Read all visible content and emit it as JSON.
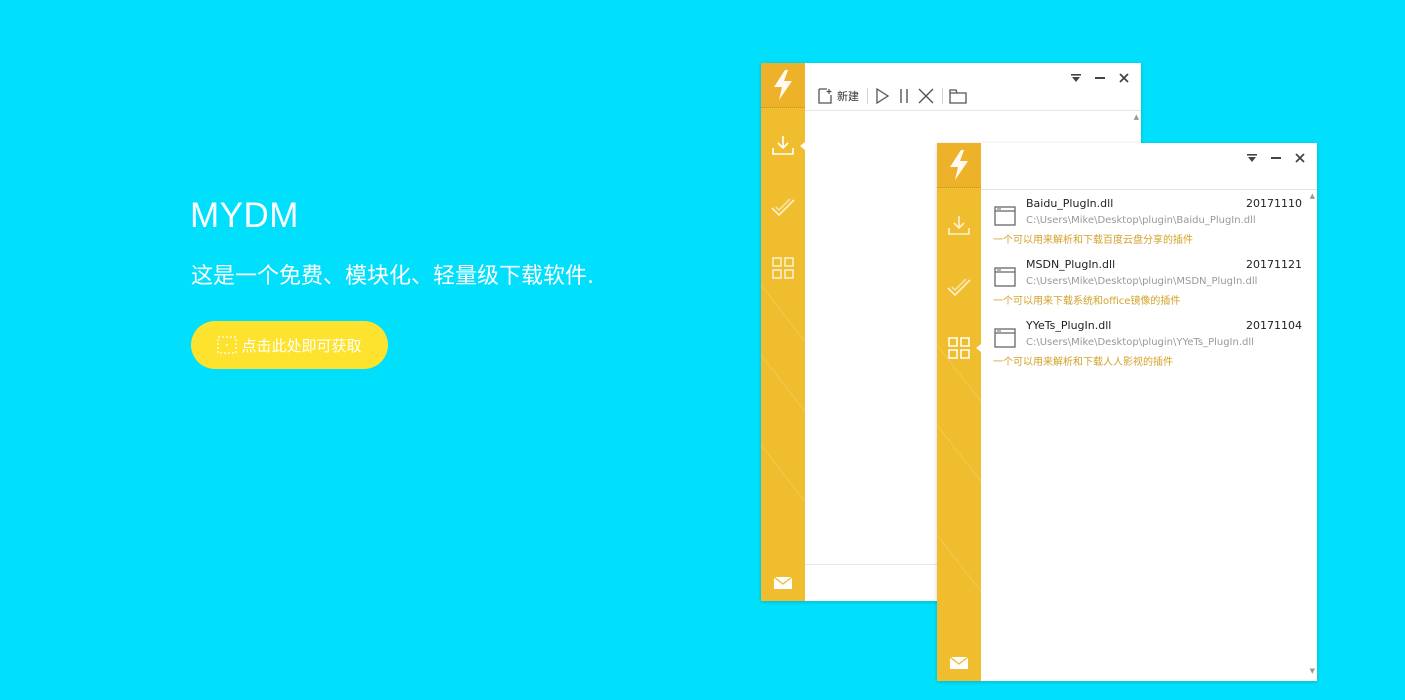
{
  "hero": {
    "title": "MYDM",
    "subtitle": "这是一个免费、模块化、轻量级下载软件.",
    "cta_label": "点击此处即可获取"
  },
  "colors": {
    "background": "#00e0fd",
    "cta": "#fde32e",
    "sidebar": "#f0bd2e",
    "plugin_desc": "#d4a22a"
  },
  "download_window": {
    "toolbar": {
      "new_label": "新建"
    },
    "sidebar_icons": [
      "lightning-logo-icon",
      "download-icon",
      "check-icon",
      "grid-icon",
      "mail-icon"
    ]
  },
  "plugin_window": {
    "plugins": [
      {
        "name": "Baidu_PlugIn.dll",
        "date": "20171110",
        "path": "C:\\Users\\Mike\\Desktop\\plugin\\Baidu_PlugIn.dll",
        "description": "一个可以用来解析和下载百度云盘分享的插件"
      },
      {
        "name": "MSDN_PlugIn.dll",
        "date": "20171121",
        "path": "C:\\Users\\Mike\\Desktop\\plugin\\MSDN_PlugIn.dll",
        "description": "一个可以用来下载系统和office镜像的插件"
      },
      {
        "name": "YYeTs_PlugIn.dll",
        "date": "20171104",
        "path": "C:\\Users\\Mike\\Desktop\\plugin\\YYeTs_PlugIn.dll",
        "description": "一个可以用来解析和下载人人影视的插件"
      }
    ]
  }
}
